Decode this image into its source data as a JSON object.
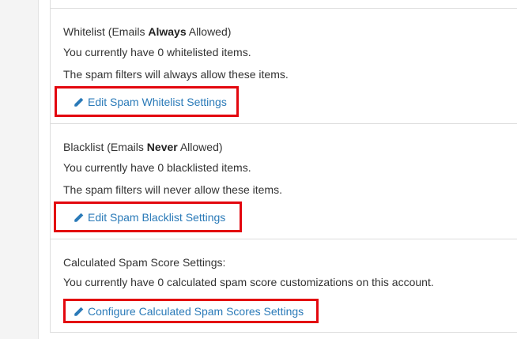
{
  "whitelist": {
    "title_pre": "Whitelist (Emails ",
    "title_bold": "Always",
    "title_post": " Allowed)",
    "count_text": "You currently have 0 whitelisted items.",
    "desc": "The spam filters will always allow these items.",
    "link_label": "Edit Spam Whitelist Settings",
    "link_icon": "pencil-icon"
  },
  "blacklist": {
    "title_pre": "Blacklist (Emails ",
    "title_bold": "Never",
    "title_post": " Allowed)",
    "count_text": "You currently have 0 blacklisted items.",
    "desc": "The spam filters will never allow these items.",
    "link_label": "Edit Spam Blacklist Settings",
    "link_icon": "pencil-icon"
  },
  "score": {
    "title": "Calculated Spam Score Settings:",
    "count_text": "You currently have 0 calculated spam score customizations on this account.",
    "link_label": "Configure Calculated Spam Scores Settings",
    "link_icon": "pencil-icon"
  },
  "colors": {
    "link": "#2a7ab8",
    "highlight": "#e3070e",
    "border": "#dddddd"
  }
}
